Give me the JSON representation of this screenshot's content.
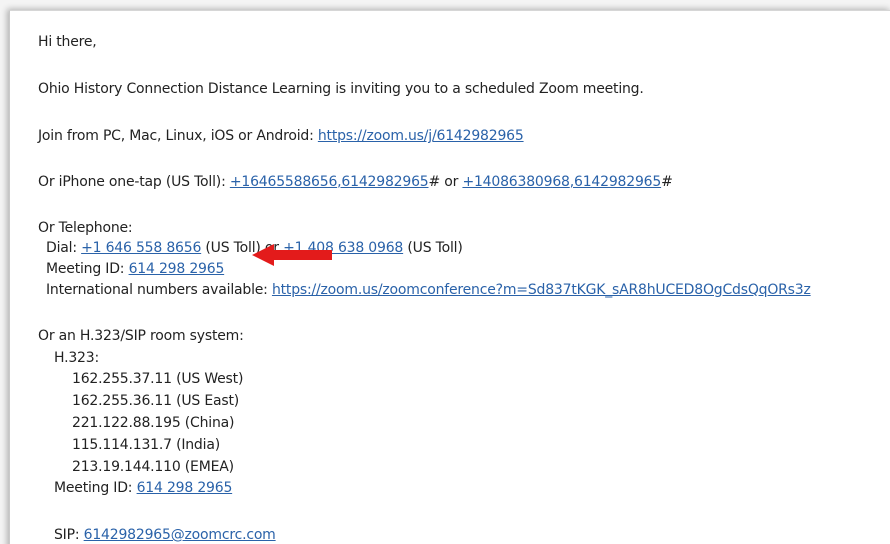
{
  "email": {
    "greeting": "Hi there,",
    "intro": "Ohio History Connection Distance Learning is inviting you to a scheduled Zoom meeting.",
    "join": {
      "label": "Join from PC, Mac, Linux, iOS or Android: ",
      "link": "https://zoom.us/j/6142982965"
    },
    "iphone": {
      "label": "Or iPhone one-tap (US Toll):  ",
      "link1_a": "+16465588656",
      "link1_b": ",6142982965",
      "sep": "# or ",
      "link2_a": "+14086380968",
      "link2_b": ",6142982965",
      "end": "#"
    },
    "telephone": {
      "heading": "Or Telephone:",
      "dial_label": "Dial: ",
      "dial_link1": "+1 646 558 8656",
      "dial_mid": " (US Toll) or ",
      "dial_link2": "+1 408 638 0968",
      "dial_end": " (US Toll)",
      "meeting_label": "Meeting ID: ",
      "meeting_id": "614 298 2965",
      "intl_label": "International numbers available: ",
      "intl_link": "https://zoom.us/zoomconference?m=Sd837tKGK_sAR8hUCED8OgCdsQqORs3z"
    },
    "sip_room": {
      "heading": "Or an H.323/SIP room system:",
      "h323_label": "H.323:",
      "ips": [
        "162.255.37.11 (US West)",
        "162.255.36.11 (US East)",
        "221.122.88.195 (China)",
        "115.114.131.7 (India)",
        "213.19.144.110 (EMEA)"
      ],
      "meeting_label": "Meeting ID: ",
      "meeting_id": "614 298 2965",
      "sip_label": "SIP: ",
      "sip_link": "6142982965@zoomcrc.com"
    }
  },
  "annotation": {
    "arrow_color": "#e31b1b",
    "arrow_icon": "red-arrow-pointing-left"
  },
  "colors": {
    "link": "#2a62a9",
    "text": "#222222"
  }
}
